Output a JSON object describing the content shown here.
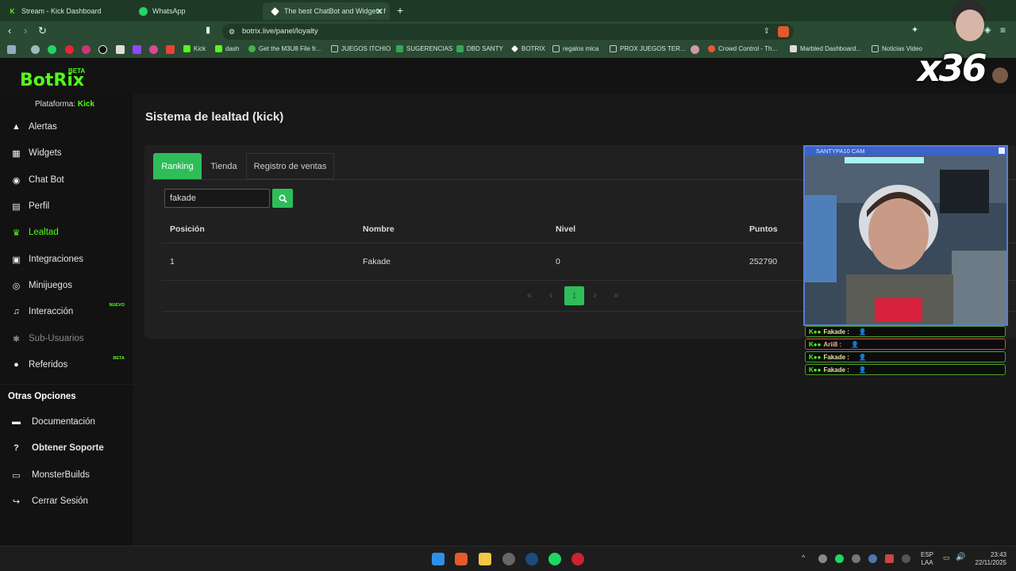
{
  "browser": {
    "tabs": [
      {
        "title": "Stream - Kick Dashboard",
        "icon": "kick-icon",
        "color": "#53fc18"
      },
      {
        "title": "WhatsApp",
        "icon": "whatsapp-icon",
        "color": "#25d366"
      },
      {
        "title": "The best ChatBot and Widgets f",
        "icon": "botrix-icon",
        "color": "#ffffff"
      }
    ],
    "url": "botrix.live/panel/loyalty",
    "bookmarks": [
      "Kick",
      "dash",
      "Get the M3U8 File fr...",
      "JUEGOS ITCHIO",
      "SUGERENCIAS",
      "DBD SANTY",
      "BOTRIX",
      "regalos mica",
      "PROX JUEGOS TER...",
      "Crowd Control - Th...",
      "Marbled Dashboard...",
      "Noticias Video"
    ]
  },
  "app": {
    "logo": "BotRix",
    "logo_badge": "BETA",
    "platform_label": "Plataforma:",
    "platform_value": "Kick",
    "accent": "#53fc18",
    "primary": "#2ebd59"
  },
  "sidebar": {
    "items": [
      {
        "label": "Alertas",
        "icon": "warning-icon"
      },
      {
        "label": "Widgets",
        "icon": "widgets-icon"
      },
      {
        "label": "Chat Bot",
        "icon": "robot-icon"
      },
      {
        "label": "Perfil",
        "icon": "id-card-icon"
      },
      {
        "label": "Lealtad",
        "icon": "trophy-icon"
      },
      {
        "label": "Integraciones",
        "icon": "integrations-icon"
      },
      {
        "label": "Minijuegos",
        "icon": "gamepad-icon"
      },
      {
        "label": "Interacción",
        "icon": "music-icon",
        "badge": "NUEVO"
      },
      {
        "label": "Sub-Usuarios",
        "icon": "sub-users-icon"
      },
      {
        "label": "Referidos",
        "icon": "users-icon",
        "badge": "BETA"
      }
    ],
    "other_title": "Otras Opciones",
    "other_items": [
      {
        "label": "Documentación",
        "icon": "book-icon"
      },
      {
        "label": "Obtener Soporte",
        "icon": "question-icon"
      },
      {
        "label": "MonsterBuilds",
        "icon": "laptop-icon"
      },
      {
        "label": "Cerrar Sesión",
        "icon": "logout-icon"
      }
    ]
  },
  "page": {
    "title": "Sistema de lealtad (kick)",
    "tabs": [
      "Ranking",
      "Tienda",
      "Registro de ventas"
    ],
    "search_value": "fakade",
    "table": {
      "headers": [
        "Posición",
        "Nombre",
        "Nivel",
        "Puntos"
      ],
      "rows": [
        [
          "1",
          "Fakade",
          "0",
          "252790"
        ]
      ]
    },
    "pagination": {
      "current": "1",
      "first": "«",
      "prev": "‹",
      "next": "›",
      "last": "»"
    }
  },
  "overlay": {
    "cam_title": "SANTYPA10 CAM",
    "chat": [
      {
        "user": "Fakade :",
        "style": "green"
      },
      {
        "user": "Arii8 :",
        "style": "red"
      },
      {
        "user": "Fakade :",
        "style": "green"
      },
      {
        "user": "Fakade :",
        "style": "green"
      }
    ],
    "combo": "x36"
  },
  "taskbar": {
    "lang1": "ESP",
    "lang2": "LAA",
    "time": "23:43",
    "date": "22/11/2025"
  }
}
